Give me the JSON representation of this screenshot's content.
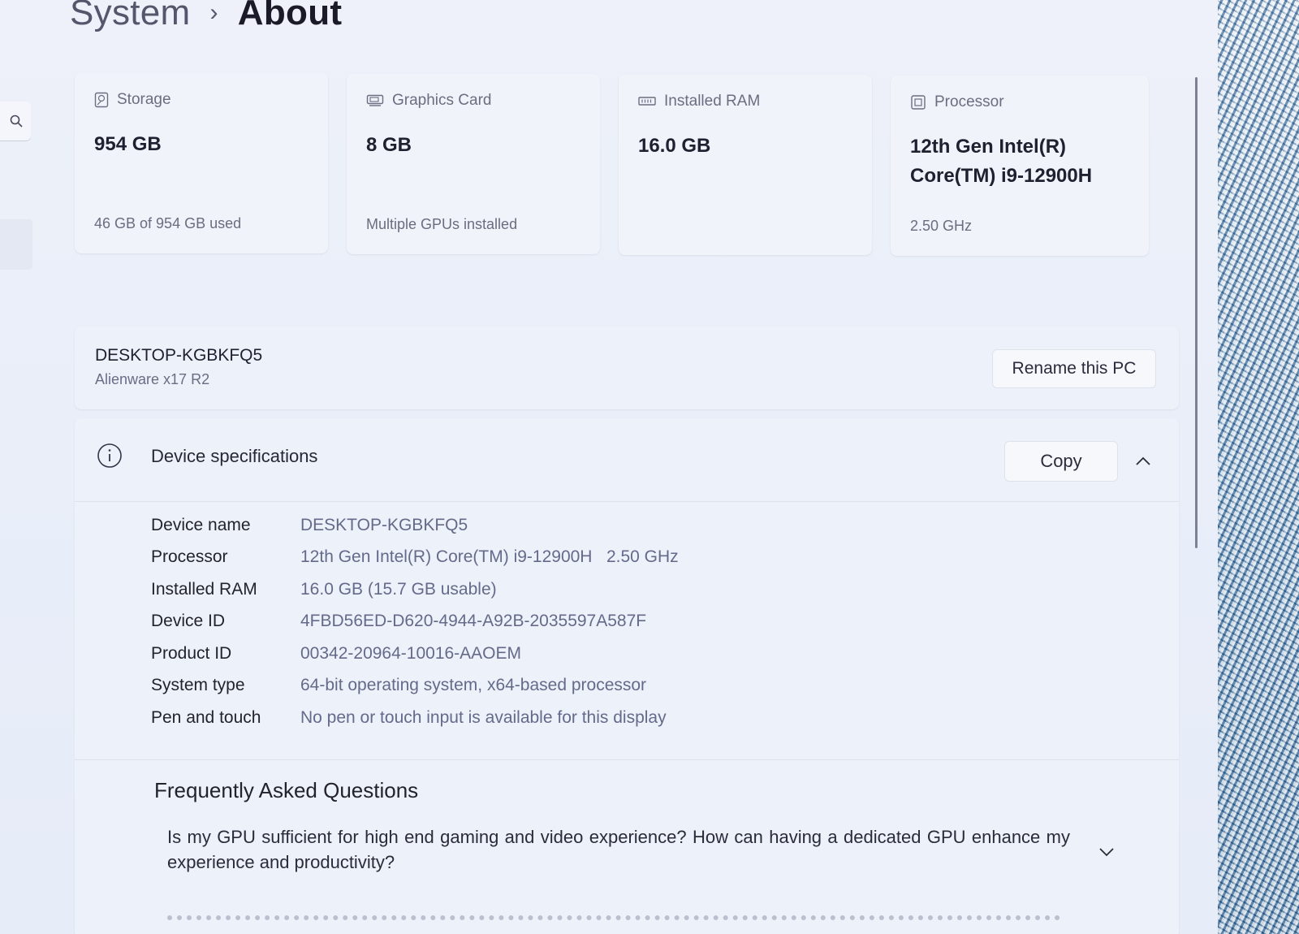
{
  "breadcrumb": {
    "parent": "System",
    "separator": "›",
    "current": "About"
  },
  "cards": [
    {
      "icon": "storage-icon",
      "title": "Storage",
      "value": "954 GB",
      "sub": "46 GB of 954 GB used"
    },
    {
      "icon": "graphics-card-icon",
      "title": "Graphics Card",
      "value": "8 GB",
      "sub": "Multiple GPUs installed"
    },
    {
      "icon": "ram-icon",
      "title": "Installed RAM",
      "value": "16.0 GB",
      "sub": ""
    },
    {
      "icon": "processor-icon",
      "title": "Processor",
      "value": "12th Gen Intel(R) Core(TM) i9-12900H",
      "sub": "2.50 GHz"
    }
  ],
  "pc": {
    "name": "DESKTOP-KGBKFQ5",
    "model": "Alienware x17 R2",
    "rename_label": "Rename this PC"
  },
  "specs": {
    "title": "Device specifications",
    "copy_label": "Copy",
    "rows": [
      {
        "label": "Device name",
        "value": "DESKTOP-KGBKFQ5"
      },
      {
        "label": "Processor",
        "value": "12th Gen Intel(R) Core(TM) i9-12900H   2.50 GHz"
      },
      {
        "label": "Installed RAM",
        "value": "16.0 GB (15.7 GB usable)"
      },
      {
        "label": "Device ID",
        "value": "4FBD56ED-D620-4944-A92B-2035597A587F"
      },
      {
        "label": "Product ID",
        "value": "00342-20964-10016-AAOEM"
      },
      {
        "label": "System type",
        "value": "64-bit operating system, x64-based processor"
      },
      {
        "label": "Pen and touch",
        "value": "No pen or touch input is available for this display"
      }
    ]
  },
  "faq": {
    "title": "Frequently Asked Questions",
    "question": "Is my GPU sufficient for high end gaming and video experience? How can having a dedicated GPU enhance my experience and productivity?"
  },
  "icons": {
    "nav_search": "search-icon",
    "spec_header": "info-icon",
    "collapse": "chevron-up-icon",
    "faq_expand": "chevron-down-icon"
  },
  "colors": {
    "background": "#eef1f9",
    "card": "#f0f3fa",
    "value_text": "#656a8a"
  }
}
